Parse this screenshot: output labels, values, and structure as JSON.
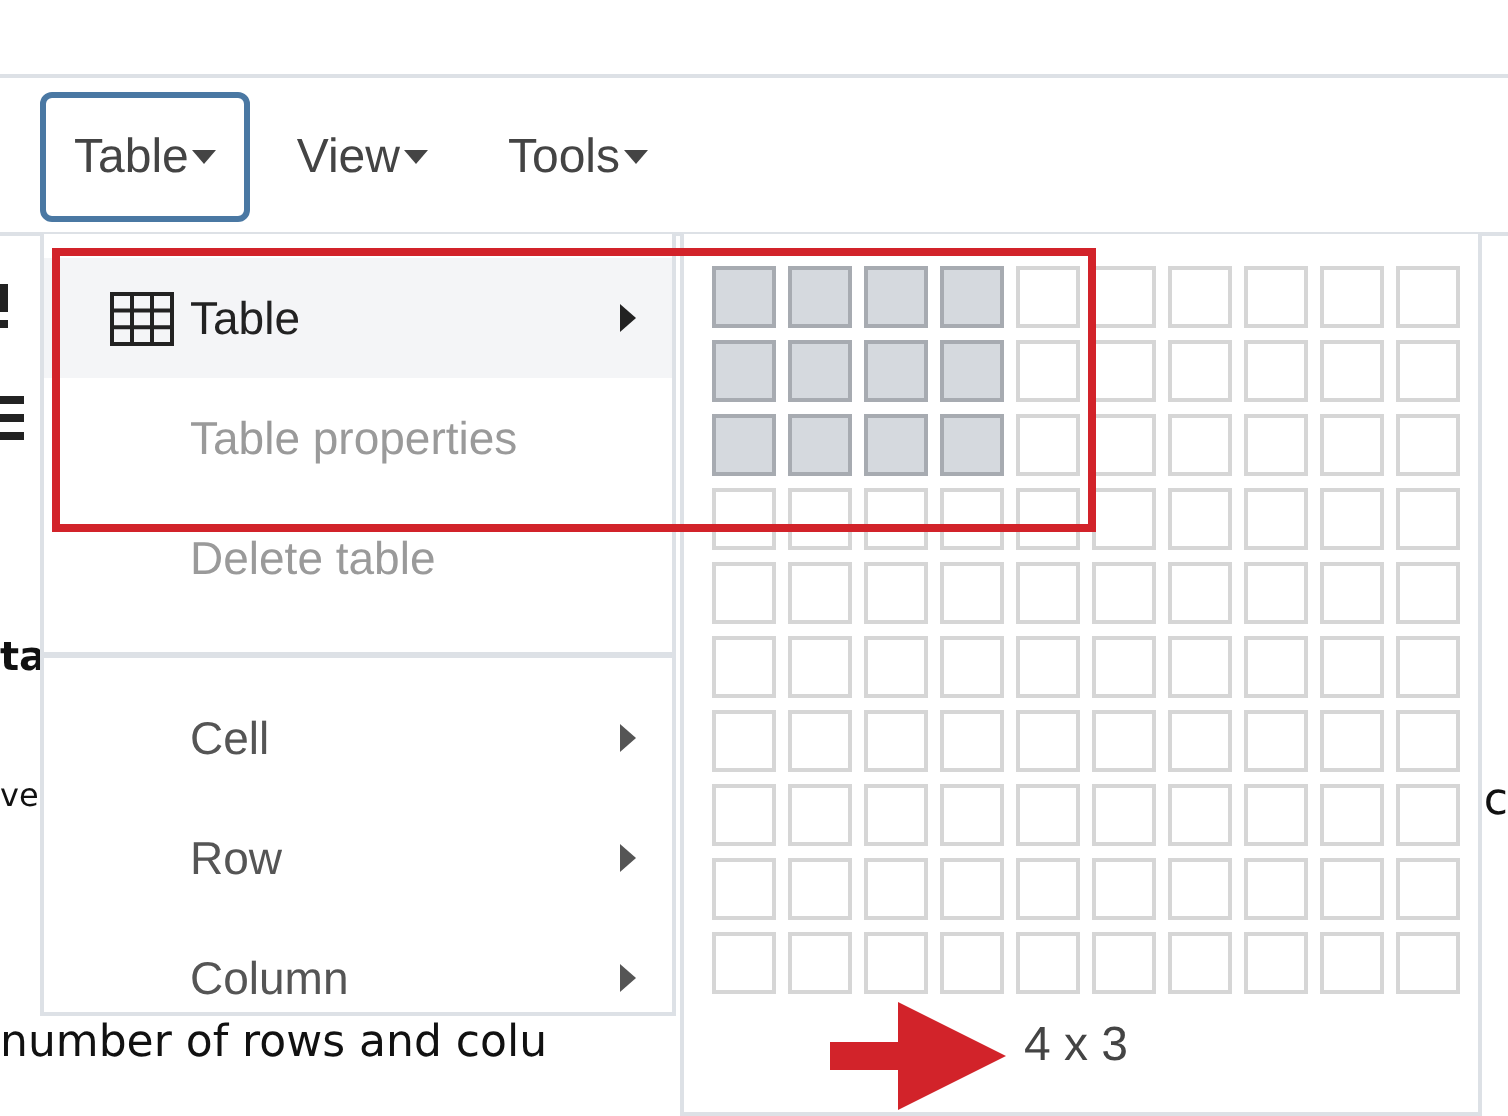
{
  "menubar": [
    {
      "label": "Table",
      "selected": true
    },
    {
      "label": "View",
      "selected": false
    },
    {
      "label": "Tools",
      "selected": false
    }
  ],
  "editor": {
    "heading_fragment": "ta",
    "line_fragments": [
      "ve",
      "c"
    ],
    "bottom_text": "number of rows and colu"
  },
  "menu": {
    "items": [
      {
        "label": "Table",
        "kind": "table",
        "highlighted": true,
        "disabled": false,
        "submenu": true,
        "separator_before": false
      },
      {
        "label": "Table properties",
        "kind": "plain",
        "highlighted": false,
        "disabled": true,
        "submenu": false,
        "separator_before": false
      },
      {
        "label": "Delete table",
        "kind": "plain",
        "highlighted": false,
        "disabled": true,
        "submenu": false,
        "separator_before": false
      },
      {
        "label": "Cell",
        "kind": "plain",
        "highlighted": false,
        "disabled": false,
        "submenu": true,
        "separator_before": true
      },
      {
        "label": "Row",
        "kind": "plain",
        "highlighted": false,
        "disabled": false,
        "submenu": true,
        "separator_before": false
      },
      {
        "label": "Column",
        "kind": "plain",
        "highlighted": false,
        "disabled": false,
        "submenu": true,
        "separator_before": false
      }
    ]
  },
  "table_grid": {
    "size_label": "4 x 3",
    "rows": [
      {
        "cells": [
          true,
          true,
          true,
          true,
          false,
          false,
          false,
          false,
          false,
          false
        ]
      },
      {
        "cells": [
          true,
          true,
          true,
          true,
          false,
          false,
          false,
          false,
          false,
          false
        ]
      },
      {
        "cells": [
          true,
          true,
          true,
          true,
          false,
          false,
          false,
          false,
          false,
          false
        ]
      },
      {
        "cells": [
          false,
          false,
          false,
          false,
          false,
          false,
          false,
          false,
          false,
          false
        ]
      },
      {
        "cells": [
          false,
          false,
          false,
          false,
          false,
          false,
          false,
          false,
          false,
          false
        ]
      },
      {
        "cells": [
          false,
          false,
          false,
          false,
          false,
          false,
          false,
          false,
          false,
          false
        ]
      },
      {
        "cells": [
          false,
          false,
          false,
          false,
          false,
          false,
          false,
          false,
          false,
          false
        ]
      },
      {
        "cells": [
          false,
          false,
          false,
          false,
          false,
          false,
          false,
          false,
          false,
          false
        ]
      },
      {
        "cells": [
          false,
          false,
          false,
          false,
          false,
          false,
          false,
          false,
          false,
          false
        ]
      },
      {
        "cells": [
          false,
          false,
          false,
          false,
          false,
          false,
          false,
          false,
          false,
          false
        ]
      }
    ]
  }
}
